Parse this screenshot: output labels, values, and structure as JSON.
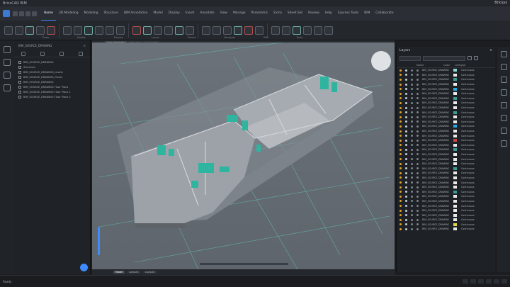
{
  "titlebar": {
    "app_name": "BricsCAD BIM",
    "account": "Bricsys"
  },
  "menu": {
    "tabs": [
      "Home",
      "3D Modeling",
      "Modeling",
      "Structure",
      "BIM Annotation",
      "Model",
      "Display",
      "Insert",
      "Annotate",
      "View",
      "Manage",
      "Parametric",
      "Extra",
      "Sheet Set",
      "Review",
      "Help",
      "Express Tools",
      "BIM",
      "Collaborate"
    ]
  },
  "ribbon": {
    "groups": [
      "Draw",
      "Modify",
      "Display",
      "Layers",
      "Blocks",
      "Navigate",
      "BIM",
      "Tools"
    ]
  },
  "browser": {
    "title": "BIM_SOURCE_DRAWING",
    "items": [
      "BIM_SOURCE_DRAWING",
      "Structure",
      "BIM_SOURCE_DRAWING_Levels",
      "BIM_SOURCE_DRAWING_Floors",
      "BIM_SOURCE_DRAWING",
      "BIM_SOURCE_DRAWING Floor Plans",
      "BIM_SOURCE_DRAWING Floor Plans 1",
      "BIM_SOURCE_DRAWING Floor Plans 2"
    ]
  },
  "viewport": {
    "tabs": [
      "BIM_SOURCE",
      "Model",
      "Layout1"
    ],
    "view_label": "Top"
  },
  "layout_tabs": [
    "Model",
    "Layout1",
    "Layout2"
  ],
  "layers": {
    "title": "Layers",
    "filter": "Show all",
    "current": "BIM_SOURCE_DRAWING",
    "columns": [
      "",
      "",
      "",
      "",
      "Name",
      "Color",
      "Linetype"
    ],
    "rows": [
      {
        "name": "BIM_SOURCE_DRAWING",
        "color": "#8fd6cf",
        "lt": "Continuous"
      },
      {
        "name": "BIM_SOURCE_DRAWING",
        "color": "#e8e8e8",
        "lt": "Continuous"
      },
      {
        "name": "BIM_SOURCE_DRAWING",
        "color": "#3d9c94",
        "lt": "Continuous"
      },
      {
        "name": "BIM_SOURCE_DRAWING",
        "color": "#e8e8e8",
        "lt": "Continuous"
      },
      {
        "name": "BIM_SOURCE_DRAWING",
        "color": "#2aa9e0",
        "lt": "Continuous"
      },
      {
        "name": "BIM_SOURCE_DRAWING",
        "color": "#e8e8e8",
        "lt": "Continuous"
      },
      {
        "name": "BIM_SOURCE_DRAWING",
        "color": "#3d9c94",
        "lt": "Continuous"
      },
      {
        "name": "BIM_SOURCE_DRAWING",
        "color": "#e8e8e8",
        "lt": "Continuous"
      },
      {
        "name": "BIM_SOURCE_DRAWING",
        "color": "#e8e8e8",
        "lt": "Continuous"
      },
      {
        "name": "BIM_SOURCE_DRAWING",
        "color": "#3d9c94",
        "lt": "Continuous"
      },
      {
        "name": "BIM_SOURCE_DRAWING",
        "color": "#e8e8e8",
        "lt": "Continuous"
      },
      {
        "name": "BIM_SOURCE_DRAWING",
        "color": "#e8e8e8",
        "lt": "Continuous"
      },
      {
        "name": "BIM_SOURCE_DRAWING",
        "color": "#2aa9e0",
        "lt": "Continuous"
      },
      {
        "name": "BIM_SOURCE_DRAWING",
        "color": "#e8e8e8",
        "lt": "Continuous"
      },
      {
        "name": "BIM_SOURCE_DRAWING",
        "color": "#e8e8e8",
        "lt": "Continuous"
      },
      {
        "name": "BIM_SOURCE_DRAWING",
        "color": "#c94444",
        "lt": "Continuous"
      },
      {
        "name": "BIM_SOURCE_DRAWING",
        "color": "#e8e8e8",
        "lt": "Continuous"
      },
      {
        "name": "BIM_SOURCE_DRAWING",
        "color": "#3d9c94",
        "lt": "Continuous"
      },
      {
        "name": "BIM_SOURCE_DRAWING",
        "color": "#e8e8e8",
        "lt": "Continuous"
      },
      {
        "name": "BIM_SOURCE_DRAWING",
        "color": "#e8e8e8",
        "lt": "Continuous"
      },
      {
        "name": "BIM_SOURCE_DRAWING",
        "color": "#e8e8e8",
        "lt": "Continuous"
      },
      {
        "name": "BIM_SOURCE_DRAWING",
        "color": "#3d9c94",
        "lt": "Continuous"
      },
      {
        "name": "BIM_SOURCE_DRAWING",
        "color": "#e8e8e8",
        "lt": "Continuous"
      },
      {
        "name": "BIM_SOURCE_DRAWING",
        "color": "#e8e8e8",
        "lt": "Continuous"
      },
      {
        "name": "BIM_SOURCE_DRAWING",
        "color": "#e8e8e8",
        "lt": "Continuous"
      },
      {
        "name": "BIM_SOURCE_DRAWING",
        "color": "#e8e8e8",
        "lt": "Continuous"
      },
      {
        "name": "BIM_SOURCE_DRAWING",
        "color": "#3d9c94",
        "lt": "Continuous"
      },
      {
        "name": "BIM_SOURCE_DRAWING",
        "color": "#e8e8e8",
        "lt": "Continuous"
      },
      {
        "name": "BIM_SOURCE_DRAWING",
        "color": "#e8e8e8",
        "lt": "Continuous"
      },
      {
        "name": "BIM_SOURCE_DRAWING",
        "color": "#e8e8e8",
        "lt": "Continuous"
      },
      {
        "name": "BIM_SOURCE_DRAWING",
        "color": "#e8e8e8",
        "lt": "Continuous"
      },
      {
        "name": "BIM_SOURCE_DRAWING",
        "color": "#e8e8e8",
        "lt": "Continuous"
      },
      {
        "name": "BIM_SOURCE_DRAWING",
        "color": "#e8e8e8",
        "lt": "Continuous"
      },
      {
        "name": "BIM_SOURCE_DRAWING",
        "color": "#e3d44a",
        "lt": "Continuous"
      },
      {
        "name": "BIM_SOURCE_DRAWING",
        "color": "#e8e8e8",
        "lt": "Continuous"
      }
    ]
  },
  "status": {
    "left": "Ready"
  },
  "colors": {
    "accent": "#3d8bff",
    "model_teal": "#2fb59f",
    "background": "#1b1d21"
  }
}
